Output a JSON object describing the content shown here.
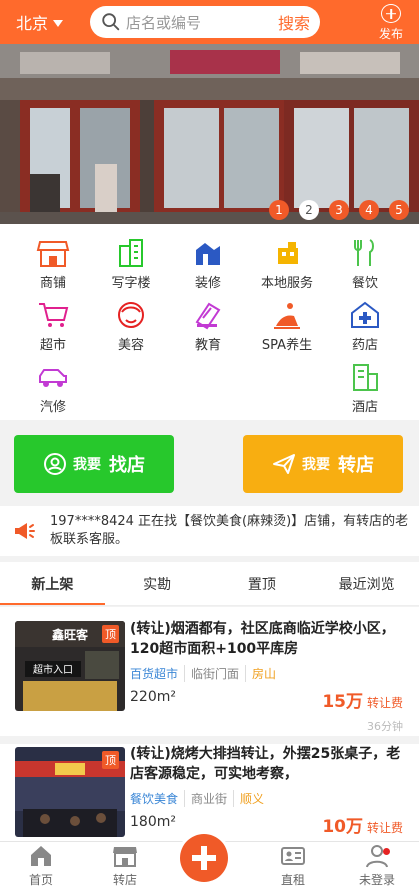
{
  "header": {
    "city": "北京",
    "search_placeholder": "店名或编号",
    "search_button": "搜索",
    "publish_label": "发布"
  },
  "banner": {
    "pages": [
      "1",
      "2",
      "3",
      "4",
      "5"
    ],
    "active_page": "2"
  },
  "categories": [
    {
      "label": "商铺",
      "icon": "shop-icon",
      "color": "#f05a28"
    },
    {
      "label": "写字楼",
      "icon": "office-building-icon",
      "color": "#27c82c"
    },
    {
      "label": "装修",
      "icon": "decoration-icon",
      "color": "#2b59c3"
    },
    {
      "label": "本地服务",
      "icon": "local-service-icon",
      "color": "#f5b400"
    },
    {
      "label": "餐饮",
      "icon": "dining-icon",
      "color": "#4cc44c"
    },
    {
      "label": "超市",
      "icon": "cart-icon",
      "color": "#e0208e"
    },
    {
      "label": "美容",
      "icon": "beauty-icon",
      "color": "#e52222"
    },
    {
      "label": "教育",
      "icon": "education-icon",
      "color": "#c23ad3"
    },
    {
      "label": "SPA养生",
      "icon": "spa-icon",
      "color": "#f05a28"
    },
    {
      "label": "药店",
      "icon": "pharmacy-icon",
      "color": "#2b59c3"
    },
    {
      "label": "汽修",
      "icon": "car-repair-icon",
      "color": "#c23ad3"
    },
    {
      "label": "酒店",
      "icon": "hotel-icon",
      "color": "#4cc44c"
    }
  ],
  "actions": {
    "find": {
      "small": "我要",
      "big": "找店"
    },
    "transfer": {
      "small": "我要",
      "big": "转店"
    }
  },
  "notice": "197****8424 正在找【餐饮美食(麻辣烫)】店铺，有转店的老板联系客服。",
  "tabs": [
    "新上架",
    "实勘",
    "置顶",
    "最近浏览"
  ],
  "listings": [
    {
      "title": "(转让)烟酒都有，社区底商临近学校小区，120超市面积+100平库房",
      "tags": [
        "百货超市",
        "临街门面",
        "房山"
      ],
      "area": "220m²",
      "price": "15万",
      "price_unit": "转让费",
      "time": "36分钟",
      "top_tag": "顶",
      "thumb_sign": "鑫旺客",
      "thumb_sign2": "超市入口"
    },
    {
      "title": "(转让)烧烤大排挡转让，外摆25张桌子，老店客源稳定，可实地考察，",
      "tags": [
        "餐饮美食",
        "商业街",
        "顺义"
      ],
      "area": "180m²",
      "price": "10万",
      "price_unit": "转让费",
      "top_tag": "顶"
    }
  ],
  "bottom_nav": [
    "首页",
    "转店",
    "直租",
    "未登录"
  ],
  "colors": {
    "brand": "#ff6a2c",
    "green": "#27c82c",
    "yellow": "#f8ae11",
    "price": "#f05a28"
  }
}
